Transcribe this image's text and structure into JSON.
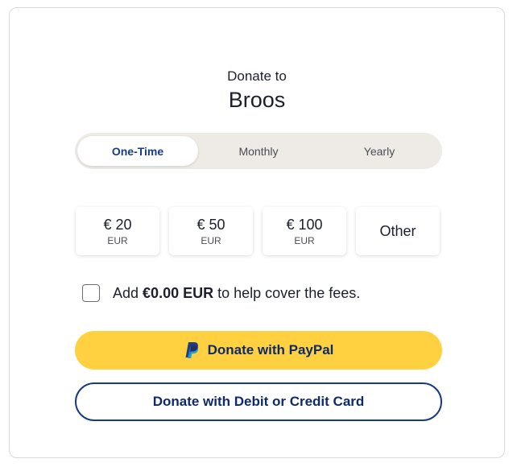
{
  "header": {
    "donate_to": "Donate to",
    "organization": "Broos"
  },
  "frequency": {
    "tabs": [
      {
        "label": "One-Time",
        "selected": true
      },
      {
        "label": "Monthly",
        "selected": false
      },
      {
        "label": "Yearly",
        "selected": false
      }
    ]
  },
  "amounts": [
    {
      "value": "€ 20",
      "currency": "EUR"
    },
    {
      "value": "€ 50",
      "currency": "EUR"
    },
    {
      "value": "€ 100",
      "currency": "EUR"
    },
    {
      "value": "Other"
    }
  ],
  "fees": {
    "checked": false,
    "prefix": "Add",
    "amount": "€0.00 EUR",
    "suffix": "to help cover the fees."
  },
  "buttons": {
    "paypal_label": "Donate with PayPal",
    "paypal_icon": "paypal-icon",
    "card_label": "Donate with Debit or Credit Card"
  },
  "colors": {
    "paypal_button": "#ffd140",
    "accent_navy": "#173b87",
    "tab_track": "#eeebe6"
  }
}
